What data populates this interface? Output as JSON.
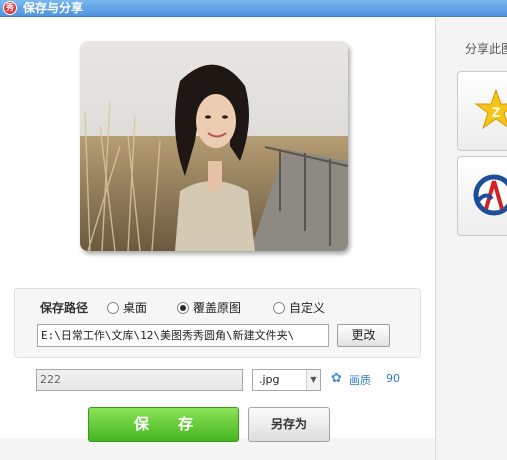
{
  "window": {
    "title": "保存与分享",
    "icon_text": "秀"
  },
  "save_path": {
    "label": "保存路径",
    "options": [
      {
        "label": "桌面",
        "selected": false
      },
      {
        "label": "覆盖原图",
        "selected": true
      },
      {
        "label": "自定义",
        "selected": false
      }
    ],
    "path_value": "E:\\日常工作\\文库\\12\\美图秀秀圆角\\新建文件夹\\",
    "change_label": "更改"
  },
  "file": {
    "name_value": "222",
    "format_value": ".jpg",
    "quality_label": "画质",
    "quality_value": "90"
  },
  "actions": {
    "save_label": "保 存",
    "save_as_label": "另存为"
  },
  "share": {
    "label": "分享此图"
  },
  "colors": {
    "titlebar": "#4f94de",
    "save_button": "#45b51f",
    "link": "#2f7fc9"
  },
  "icons": {
    "settings": "gear-icon",
    "qzone": "qzone-star-icon",
    "renren": "renren-icon"
  }
}
